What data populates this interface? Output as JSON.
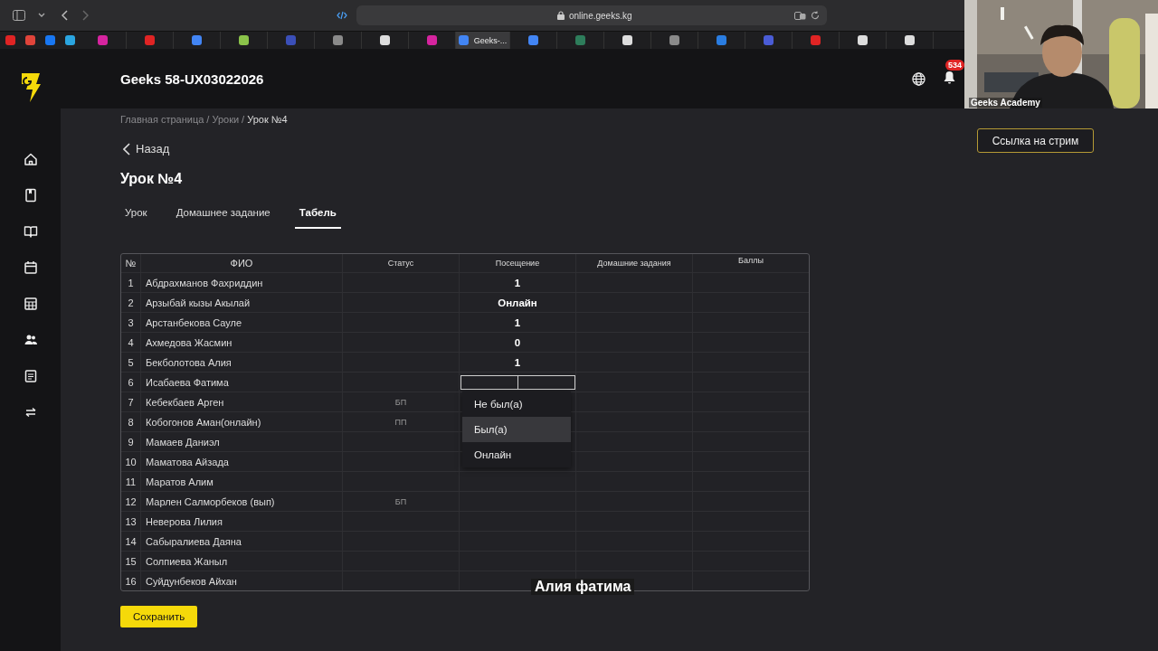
{
  "browser": {
    "address": "online.geeks.kg",
    "tabs": [
      {
        "kind": "pinned",
        "color": "#e02424",
        "selected": false
      },
      {
        "kind": "pinned",
        "color": "#e0443a",
        "selected": false
      },
      {
        "kind": "pinned",
        "color": "#1877f2",
        "selected": false
      },
      {
        "kind": "pinned",
        "color": "#2aa5e0",
        "selected": false
      },
      {
        "kind": "tab",
        "color": "#d6249f",
        "selected": false
      },
      {
        "kind": "tab",
        "color": "#e02424",
        "selected": false
      },
      {
        "kind": "tab",
        "color": "#4285f4",
        "selected": false
      },
      {
        "kind": "tab",
        "color": "#8bc34a",
        "selected": false
      },
      {
        "kind": "tab",
        "color": "#3b4fb8",
        "selected": false
      },
      {
        "kind": "tab",
        "color": "#8a8a8a",
        "selected": false
      },
      {
        "kind": "tab",
        "color": "#dddddd",
        "selected": false
      },
      {
        "kind": "tab",
        "color": "#d6249f",
        "selected": false
      },
      {
        "kind": "tab",
        "color": "#4285f4",
        "selected": true,
        "title": "Geeks-..."
      },
      {
        "kind": "tab",
        "color": "#4285f4",
        "selected": false
      },
      {
        "kind": "tab",
        "color": "#2e7d5b",
        "selected": false
      },
      {
        "kind": "tab",
        "color": "#dddddd",
        "selected": false
      },
      {
        "kind": "tab",
        "color": "#8a8a8a",
        "selected": false
      },
      {
        "kind": "tab",
        "color": "#2a7de1",
        "selected": false
      },
      {
        "kind": "tab",
        "color": "#4a5cd6",
        "selected": false
      },
      {
        "kind": "tab",
        "color": "#e02424",
        "selected": false
      },
      {
        "kind": "tab",
        "color": "#dddddd",
        "selected": false
      },
      {
        "kind": "tab",
        "color": "#dddddd",
        "selected": false
      }
    ]
  },
  "app": {
    "title": "Geeks 58-UX03022026",
    "notification_count": "534"
  },
  "sidebar": {
    "items": [
      {
        "kind": "home"
      },
      {
        "kind": "bookmark"
      },
      {
        "kind": "book"
      },
      {
        "kind": "calendar"
      },
      {
        "kind": "grid"
      },
      {
        "kind": "people"
      },
      {
        "kind": "document"
      },
      {
        "kind": "swap"
      }
    ]
  },
  "breadcrumb_separator": "/",
  "breadcrumbs": [
    {
      "label": "Главная страница",
      "current": false
    },
    {
      "label": "Уроки",
      "current": false
    },
    {
      "label": "Урок №4",
      "current": true
    }
  ],
  "back": "Назад",
  "heading": "Урок №4",
  "stream_button": "Ссылка на стрим",
  "tabs": [
    {
      "label": "Урок",
      "selected": false
    },
    {
      "label": "Домашнее задание",
      "selected": false
    },
    {
      "label": "Табель",
      "selected": true
    }
  ],
  "table": {
    "columns": [
      "№",
      "ФИО",
      "Статус",
      "Посещение",
      "Домашние задания",
      "Баллы"
    ],
    "rows": [
      {
        "number": "1",
        "name": "Абдрахманов Фахриддин",
        "attendance": "1"
      },
      {
        "number": "2",
        "name": "Арзыбай кызы Акылай",
        "attendance": "Онлайн"
      },
      {
        "number": "3",
        "name": "Арстанбекова Сауле",
        "attendance": "1"
      },
      {
        "number": "4",
        "name": "Ахмедова Жасмин",
        "attendance": "0"
      },
      {
        "number": "5",
        "name": "Бекболотова Алия",
        "attendance": "1"
      },
      {
        "number": "6",
        "name": "Исабаева Фатима",
        "editing": true
      },
      {
        "number": "7",
        "name": "Кебекбаев Арген",
        "status": "БП"
      },
      {
        "number": "8",
        "name": "Кобогонов Аман(онлайн)",
        "status": "ПП"
      },
      {
        "number": "9",
        "name": "Мамаев Даниэл"
      },
      {
        "number": "10",
        "name": "Маматова Айзада"
      },
      {
        "number": "11",
        "name": "Маратов Алим"
      },
      {
        "number": "12",
        "name": "Марлен Салморбеков (вып)",
        "status": "БП"
      },
      {
        "number": "13",
        "name": "Неверова Лилия"
      },
      {
        "number": "14",
        "name": "Сабыралиева Даяна"
      },
      {
        "number": "15",
        "name": "Солпиева Жаныл"
      },
      {
        "number": "16",
        "name": "Суйдунбеков Айхан"
      }
    ]
  },
  "dropdown": {
    "options": [
      {
        "label": "Не был(а)",
        "highlighted": false
      },
      {
        "label": "Был(а)",
        "highlighted": true
      },
      {
        "label": "Онлайн",
        "highlighted": false
      }
    ]
  },
  "save_button": "Сохранить",
  "caption": "Алия фатима",
  "video": {
    "kind": "picture",
    "label": "Geeks Academy"
  }
}
